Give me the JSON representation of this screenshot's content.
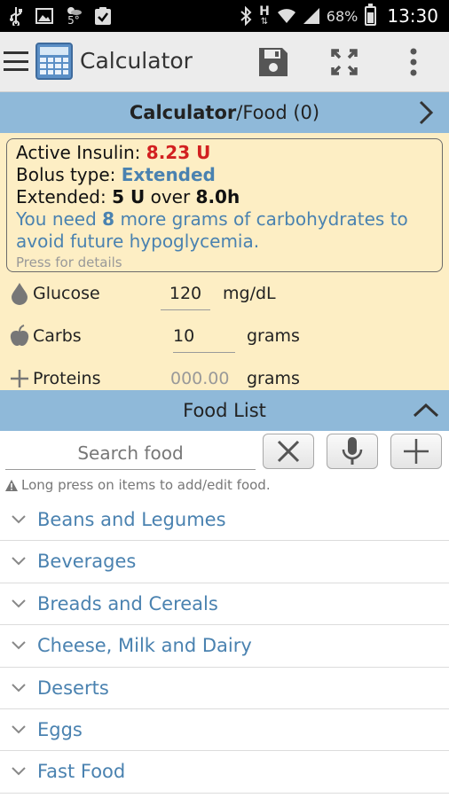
{
  "status_bar": {
    "temperature": "5°",
    "battery": "68%",
    "battery_level": 0.68,
    "network": "H",
    "time": "13:30"
  },
  "action_bar": {
    "title": "Calculator"
  },
  "header_tab": {
    "active": "Calculator",
    "rest": "/Food (0)"
  },
  "summary": {
    "active_insulin_label": "Active Insulin: ",
    "active_insulin_value": "8.23 U",
    "bolus_type_label": "Bolus type: ",
    "bolus_type_value": "Extended",
    "extended_label": "Extended: ",
    "extended_amount": "5 U",
    "extended_over": " over ",
    "extended_duration": "8.0h",
    "advice_prefix": "You need ",
    "advice_amount": "8",
    "advice_suffix": " more grams of carbohydrates to avoid future hypoglycemia.",
    "details_hint": "Press for details"
  },
  "inputs": {
    "glucose": {
      "label": "Glucose",
      "value": "120",
      "unit": "mg/dL"
    },
    "carbs": {
      "label": "Carbs",
      "value": "10",
      "unit": "grams"
    },
    "proteins": {
      "label": "Proteins",
      "placeholder": "000.00",
      "unit": "grams"
    }
  },
  "food_list": {
    "title": "Food List",
    "search_placeholder": "Search food",
    "hint": "Long press on items to add/edit food.",
    "categories": [
      "Beans and Legumes",
      "Beverages",
      "Breads and Cereals",
      "Cheese, Milk and Dairy",
      "Deserts",
      "Eggs",
      "Fast Food"
    ]
  },
  "colors": {
    "header_blue": "#8fb9d9",
    "panel_yellow": "#fdeec4",
    "link_blue": "#4a82b0",
    "alert_red": "#d22020"
  }
}
